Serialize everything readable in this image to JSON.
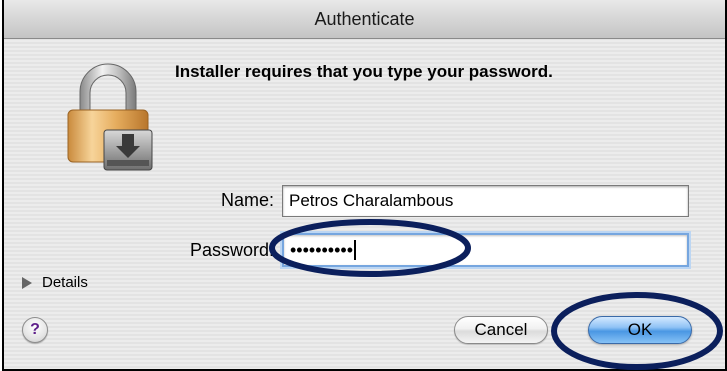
{
  "window": {
    "title": "Authenticate"
  },
  "dialog": {
    "prompt": "Installer requires that you type your password.",
    "lock_icon": "padlock-installer-icon"
  },
  "form": {
    "name_label": "Name:",
    "name_value": "Petros Charalambous",
    "password_label": "Password:",
    "password_masked": "••••••••••"
  },
  "details": {
    "label": "Details",
    "icon": "disclosure-triangle-icon"
  },
  "buttons": {
    "help_glyph": "?",
    "cancel_label": "Cancel",
    "ok_label": "OK"
  },
  "colors": {
    "annotation_ellipse": "#0b1f5c",
    "default_button": "#4a97e3",
    "focus_ring": "#76a6df"
  }
}
